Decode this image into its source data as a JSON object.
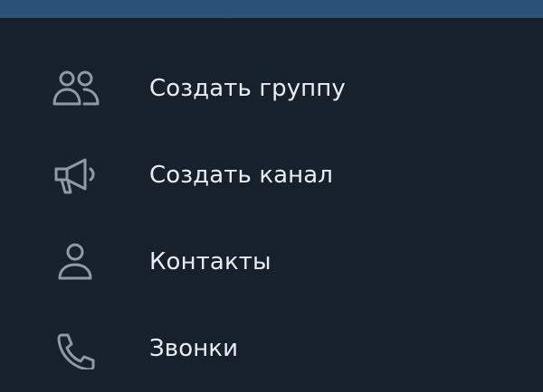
{
  "colors": {
    "background": "#17212b",
    "top_bar": "#2b5278",
    "icon": "#8f9aa5",
    "text": "#e9edf1"
  },
  "menu": {
    "items": [
      {
        "label": "Создать группу",
        "icon": "group-icon"
      },
      {
        "label": "Создать канал",
        "icon": "megaphone-icon"
      },
      {
        "label": "Контакты",
        "icon": "contact-icon"
      },
      {
        "label": "Звонки",
        "icon": "phone-icon"
      }
    ]
  }
}
